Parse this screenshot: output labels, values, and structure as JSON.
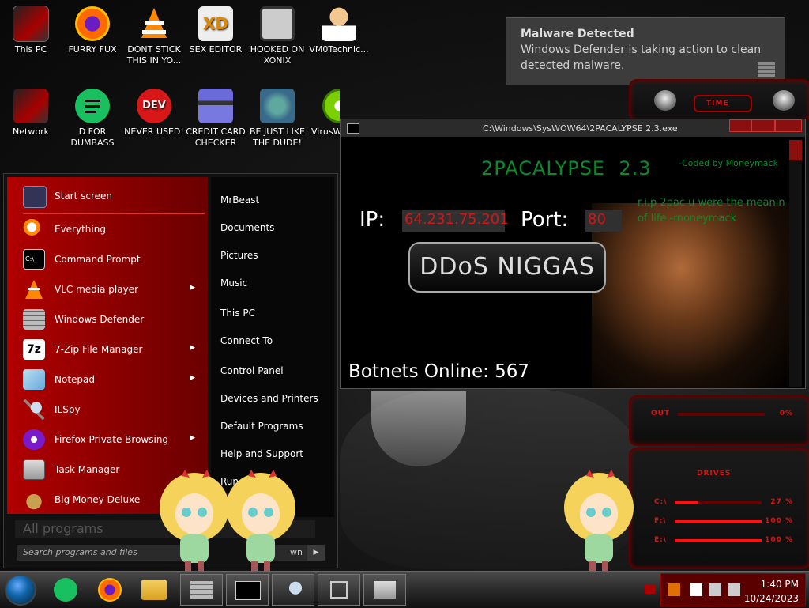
{
  "desktop": {
    "icons": [
      {
        "label": "This PC",
        "selected": true
      },
      {
        "label": "FURRY FUX"
      },
      {
        "label": "DONT STICK THIS IN YO..."
      },
      {
        "label": "SEX EDITOR"
      },
      {
        "label": "HOOKED ON XONIX"
      },
      {
        "label": "VM0Technic..."
      },
      {
        "label": "Network"
      },
      {
        "label": "D FOR DUMBASS"
      },
      {
        "label": "NEVER USED!"
      },
      {
        "label": "CREDIT CARD CHECKER"
      },
      {
        "label": "BE JUST LIKE THE DUDE!"
      },
      {
        "label": "VirusW..."
      }
    ],
    "icon_glyphs": {
      "dev": "DEV",
      "xd": "XD"
    }
  },
  "notification": {
    "title": "Malware Detected",
    "body": "Windows Defender is taking action to clean detected malware."
  },
  "gadgets": {
    "time_label": "TIME",
    "out_label": "OUT",
    "out_value": "0%",
    "drives_label": "DRIVES",
    "drives": [
      {
        "label": "C:\\",
        "value": "27 %",
        "fraction": 0.27
      },
      {
        "label": "F:\\",
        "value": "100 %",
        "fraction": 1.0
      },
      {
        "label": "E:\\",
        "value": "100 %",
        "fraction": 1.0
      }
    ]
  },
  "console_window": {
    "title": "C:\\Windows\\SysWOW64\\2PACALYPSE 2.3.exe",
    "app_title": "2PACALYPSE  2.3",
    "coded_by": "-Coded by Moneymack",
    "rip_text": "r.i.p 2pac u were the meanin of life -moneymack",
    "ip_label": "IP:",
    "ip_value": "64.231.75.201",
    "port_label": "Port:",
    "port_value": "80",
    "attack_button": "DDoS NIGGAS",
    "botnets": "Botnets Online: 567"
  },
  "start_menu": {
    "left_items": [
      {
        "label": "Start screen",
        "arrow": false
      },
      {
        "label": "Everything",
        "arrow": false
      },
      {
        "label": "Command Prompt",
        "arrow": false
      },
      {
        "label": "VLC media player",
        "arrow": true
      },
      {
        "label": "Windows Defender",
        "arrow": false
      },
      {
        "label": "7-Zip File Manager",
        "arrow": true
      },
      {
        "label": "Notepad",
        "arrow": true
      },
      {
        "label": "ILSpy",
        "arrow": false
      },
      {
        "label": "Firefox Private Browsing",
        "arrow": true
      },
      {
        "label": "Task Manager",
        "arrow": false
      },
      {
        "label": "Big Money Deluxe",
        "arrow": false
      }
    ],
    "right_items": [
      "MrBeast",
      "Documents",
      "Pictures",
      "Music",
      "This PC",
      "Connect To",
      "Control Panel",
      "Devices and Printers",
      "Default Programs",
      "Help and Support",
      "Run"
    ],
    "all_programs": "All programs",
    "search_placeholder": "Search programs and files",
    "shutdown_label": "wn",
    "arrow_glyph": "▶",
    "cmd_glyph": "C:\\_",
    "zip_glyph": "7z"
  },
  "taskbar": {
    "time": "1:40 PM",
    "date": "10/24/2023"
  },
  "colors": {
    "accent_red": "#b00000",
    "console_green": "#0a8a2a",
    "field_red": "#d01818"
  }
}
